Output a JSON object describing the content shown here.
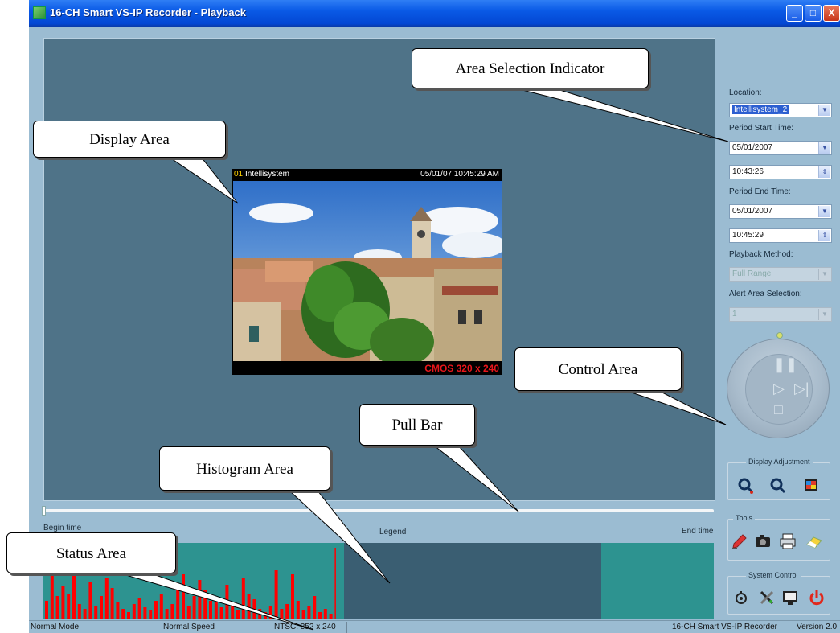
{
  "window": {
    "title": "16-CH Smart VS-IP Recorder - Playback",
    "minimize": "_",
    "maximize": "□",
    "close": "X"
  },
  "video": {
    "channel": "01",
    "camera": "Intellisystem",
    "datetime": "05/01/07 10:45:29 AM",
    "resolution": "CMOS 320 x 240"
  },
  "timeline": {
    "begin_label": "Begin time",
    "legend_label": "Legend",
    "end_label": "End time"
  },
  "panel": {
    "location_label": "Location:",
    "location_value": "Intellisystem_2",
    "period_start_label": "Period Start Time:",
    "start_date": "05/01/2007",
    "start_time": "10:43:26",
    "period_end_label": "Period End Time:",
    "end_date": "05/01/2007",
    "end_time": "10:45:29",
    "playback_method_label": "Playback Method:",
    "playback_method_value": "Full Range",
    "alert_area_label": "Alert Area Selection:",
    "alert_area_value": "1"
  },
  "groups": {
    "display_adjustment": "Display Adjustment",
    "tools": "Tools",
    "system_control": "System Control"
  },
  "status": {
    "mode": "Normal Mode",
    "speed": "Normal Speed",
    "video": "NTSC: 352 x 240",
    "product": "16-CH Smart VS-IP Recorder",
    "version": "Version 2.0"
  },
  "callouts": {
    "area_selection": "Area Selection Indicator",
    "display_area": "Display Area",
    "control_area": "Control Area",
    "pull_bar": "Pull Bar",
    "histogram_area": "Histogram Area",
    "status_area": "Status Area"
  },
  "colors": {
    "window_bg": "#9bbcd2",
    "display_bg": "#4f7388",
    "histogram_teal": "#2d9390",
    "histogram_dark": "#3a5e72",
    "histogram_bars": "#ff0000",
    "titlebar": "#0a5ae6"
  },
  "histogram_bars": [
    22,
    55,
    28,
    40,
    30,
    62,
    18,
    12,
    45,
    15,
    28,
    50,
    38,
    20,
    12,
    8,
    18,
    25,
    14,
    10,
    22,
    30,
    12,
    18,
    40,
    55,
    16,
    28,
    48,
    35,
    22,
    20,
    14,
    42,
    18,
    10,
    50,
    30,
    24,
    12,
    8,
    16,
    60,
    12,
    18,
    55,
    22,
    10,
    15,
    28,
    8,
    12,
    6,
    88
  ]
}
